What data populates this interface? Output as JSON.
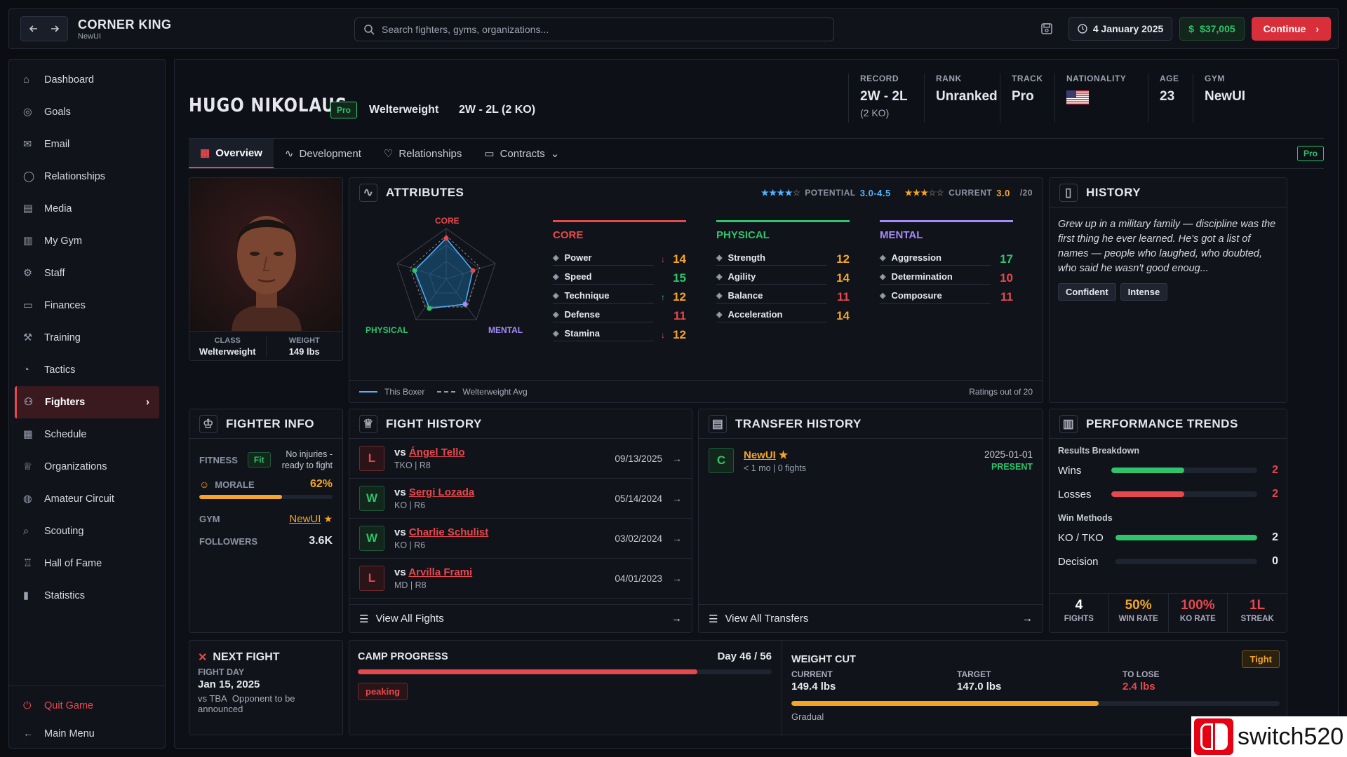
{
  "app": {
    "title": "CORNER KING",
    "subtitle": "NewUI"
  },
  "search": {
    "placeholder": "Search fighters, gyms, organizations..."
  },
  "topbar": {
    "date": "4 January 2025",
    "money": "$37,005",
    "continue_label": "Continue"
  },
  "sidebar": {
    "items": [
      {
        "label": "Dashboard",
        "icon": "home-icon"
      },
      {
        "label": "Goals",
        "icon": "target-icon"
      },
      {
        "label": "Email",
        "icon": "mail-icon"
      },
      {
        "label": "Relationships",
        "icon": "chat-icon"
      },
      {
        "label": "Media",
        "icon": "newspaper-icon"
      },
      {
        "label": "My Gym",
        "icon": "building-icon"
      },
      {
        "label": "Staff",
        "icon": "staff-icon"
      },
      {
        "label": "Finances",
        "icon": "wallet-icon"
      },
      {
        "label": "Training",
        "icon": "dumbbell-icon"
      },
      {
        "label": "Tactics",
        "icon": "tactics-icon"
      },
      {
        "label": "Fighters",
        "icon": "users-icon"
      },
      {
        "label": "Schedule",
        "icon": "calendar-icon"
      },
      {
        "label": "Organizations",
        "icon": "trophy-icon"
      },
      {
        "label": "Amateur Circuit",
        "icon": "globe-icon"
      },
      {
        "label": "Scouting",
        "icon": "search-icon"
      },
      {
        "label": "Hall of Fame",
        "icon": "award-icon"
      },
      {
        "label": "Statistics",
        "icon": "chart-icon"
      }
    ],
    "active": "Fighters",
    "quit_label": "Quit Game",
    "menu_label": "Main Menu"
  },
  "fighter": {
    "name": "HUGO NIKOLAUS",
    "badge": "Pro",
    "weight_class": "Welterweight",
    "record_text": "2W - 2L (2 KO)",
    "class_label": "CLASS",
    "class_value": "Welterweight",
    "weight_label": "WEIGHT",
    "weight_value": "149 lbs"
  },
  "stats": {
    "record_label": "RECORD",
    "record_value": "2W - 2L",
    "record_sub": "(2 KO)",
    "rank_label": "RANK",
    "rank_value": "Unranked",
    "track_label": "TRACK",
    "track_value": "Pro",
    "nationality_label": "NATIONALITY",
    "age_label": "AGE",
    "age_value": "23",
    "gym_label": "GYM",
    "gym_value": "NewUI"
  },
  "tabs": [
    {
      "label": "Overview",
      "icon": "grid-icon"
    },
    {
      "label": "Development",
      "icon": "pulse-icon"
    },
    {
      "label": "Relationships",
      "icon": "heart-icon"
    },
    {
      "label": "Contracts",
      "icon": "briefcase-icon"
    }
  ],
  "tab_badge": "Pro",
  "attributes": {
    "title": "ATTRIBUTES",
    "potential_label": "POTENTIAL",
    "potential_value": "3.0-4.5",
    "potential_stars": 4,
    "current_label": "CURRENT",
    "current_value": "3.0",
    "current_stars": 3,
    "scale": "/20",
    "radar_labels": {
      "core": "CORE",
      "physical": "PHYSICAL",
      "mental": "MENTAL"
    },
    "legend_this": "This Boxer",
    "legend_avg": "Welterweight Avg",
    "footnote": "Ratings out of 20",
    "colors": {
      "core": "#e5484d",
      "physical": "#2fc46b",
      "mental": "#a78bfa"
    },
    "core": {
      "title": "CORE",
      "items": [
        {
          "name": "Power",
          "value": "14",
          "trend": "↓"
        },
        {
          "name": "Speed",
          "value": "15",
          "trend": ""
        },
        {
          "name": "Technique",
          "value": "12",
          "trend": "↑"
        },
        {
          "name": "Defense",
          "value": "11",
          "trend": ""
        },
        {
          "name": "Stamina",
          "value": "12",
          "trend": "↓"
        }
      ]
    },
    "physical": {
      "title": "PHYSICAL",
      "items": [
        {
          "name": "Strength",
          "value": "12"
        },
        {
          "name": "Agility",
          "value": "14"
        },
        {
          "name": "Balance",
          "value": "11"
        },
        {
          "name": "Acceleration",
          "value": "14"
        }
      ]
    },
    "mental": {
      "title": "MENTAL",
      "items": [
        {
          "name": "Aggression",
          "value": "17"
        },
        {
          "name": "Determination",
          "value": "10"
        },
        {
          "name": "Composure",
          "value": "11"
        }
      ]
    }
  },
  "history": {
    "title": "HISTORY",
    "text": "Grew up in a military family — discipline was the first thing he ever learned. He's got a list of names — people who laughed, who doubted, who said he wasn't good enoug...",
    "traits": [
      "Confident",
      "Intense"
    ]
  },
  "fighter_info": {
    "title": "FIGHTER INFO",
    "fitness_label": "FITNESS",
    "fitness_badge": "Fit",
    "fitness_note": "No injuries - ready to fight",
    "morale_label": "MORALE",
    "morale_value": "62%",
    "morale_level": 0.62,
    "gym_label": "GYM",
    "gym_value": "NewUI",
    "followers_label": "FOLLOWERS",
    "followers_value": "3.6K"
  },
  "fight_history": {
    "title": "FIGHT HISTORY",
    "fights": [
      {
        "result": "L",
        "opponent": "Ángel Tello",
        "method": "TKO | R8",
        "date": "09/13/2025"
      },
      {
        "result": "W",
        "opponent": "Sergi Lozada",
        "method": "KO | R6",
        "date": "05/14/2024"
      },
      {
        "result": "W",
        "opponent": "Charlie Schulist",
        "method": "KO | R6",
        "date": "03/02/2024"
      },
      {
        "result": "L",
        "opponent": "Arvilla Frami",
        "method": "MD | R8",
        "date": "04/01/2023"
      }
    ],
    "vs": "vs",
    "view_all": "View All Fights"
  },
  "transfer_history": {
    "title": "TRANSFER HISTORY",
    "item": {
      "badge": "C",
      "gym": "NewUI",
      "meta": "< 1 mo | 0 fights",
      "date": "2025-01-01",
      "status": "PRESENT"
    },
    "view_all": "View All Transfers"
  },
  "performance": {
    "title": "PERFORMANCE TRENDS",
    "results_label": "Results Breakdown",
    "wins_label": "Wins",
    "wins_value": "2",
    "wins_fraction": 0.5,
    "losses_label": "Losses",
    "losses_value": "2",
    "losses_fraction": 0.5,
    "methods_label": "Win Methods",
    "ko_label": "KO / TKO",
    "ko_value": "2",
    "ko_fraction": 1.0,
    "dec_label": "Decision",
    "dec_value": "0",
    "dec_fraction": 0,
    "summary": [
      {
        "value": "4",
        "label": "FIGHTS",
        "color": "#ffffff"
      },
      {
        "value": "50%",
        "label": "WIN RATE",
        "color": "#f5a524"
      },
      {
        "value": "100%",
        "label": "KO RATE",
        "color": "#e5484d"
      },
      {
        "value": "1L",
        "label": "STREAK",
        "color": "#e5484d"
      }
    ]
  },
  "next_fight": {
    "title": "NEXT FIGHT",
    "day_label": "FIGHT DAY",
    "date": "Jan 15, 2025",
    "vs": "vs TBA",
    "note": "Opponent to be announced"
  },
  "camp": {
    "title": "CAMP PROGRESS",
    "day": "Day 46 / 56",
    "progress": 0.82,
    "phase": "peaking"
  },
  "weight_cut": {
    "title": "WEIGHT CUT",
    "badge": "Tight",
    "current_label": "CURRENT",
    "current_value": "149.4 lbs",
    "target_label": "TARGET",
    "target_value": "147.0 lbs",
    "tolose_label": "TO LOSE",
    "tolose_value": "2.4 lbs",
    "progress": 0.63,
    "note": "Gradual"
  },
  "watermark": "switch520"
}
